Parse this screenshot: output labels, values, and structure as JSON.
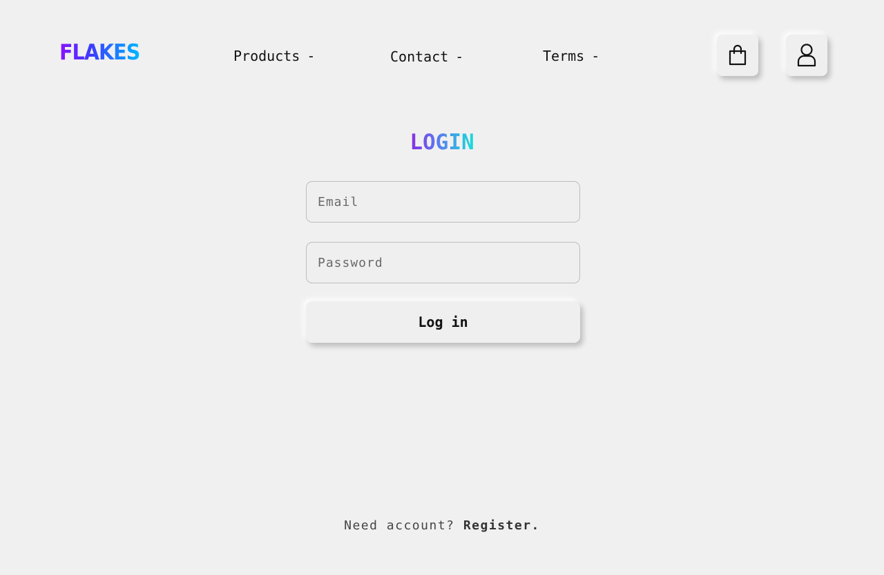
{
  "brand": {
    "logo_text": "FLAKES"
  },
  "nav": {
    "items": [
      {
        "label": "Products",
        "indicator": "-"
      },
      {
        "label": "Contact",
        "indicator": "-"
      },
      {
        "label": "Terms",
        "indicator": "-"
      }
    ]
  },
  "header_icons": {
    "cart": "shopping-bag-icon",
    "account": "user-icon"
  },
  "login": {
    "title": "LOGIN",
    "email_placeholder": "Email",
    "password_placeholder": "Password",
    "submit_label": "Log in"
  },
  "footer": {
    "prompt": "Need account?",
    "register_link": "Register."
  },
  "colors": {
    "background": "#f0f0f0",
    "logo_gradient": [
      "#8a10ff",
      "#3b3cff",
      "#00b8ff"
    ],
    "title_gradient": [
      "#8a2be2",
      "#5a7cf0",
      "#17e0d8"
    ]
  }
}
